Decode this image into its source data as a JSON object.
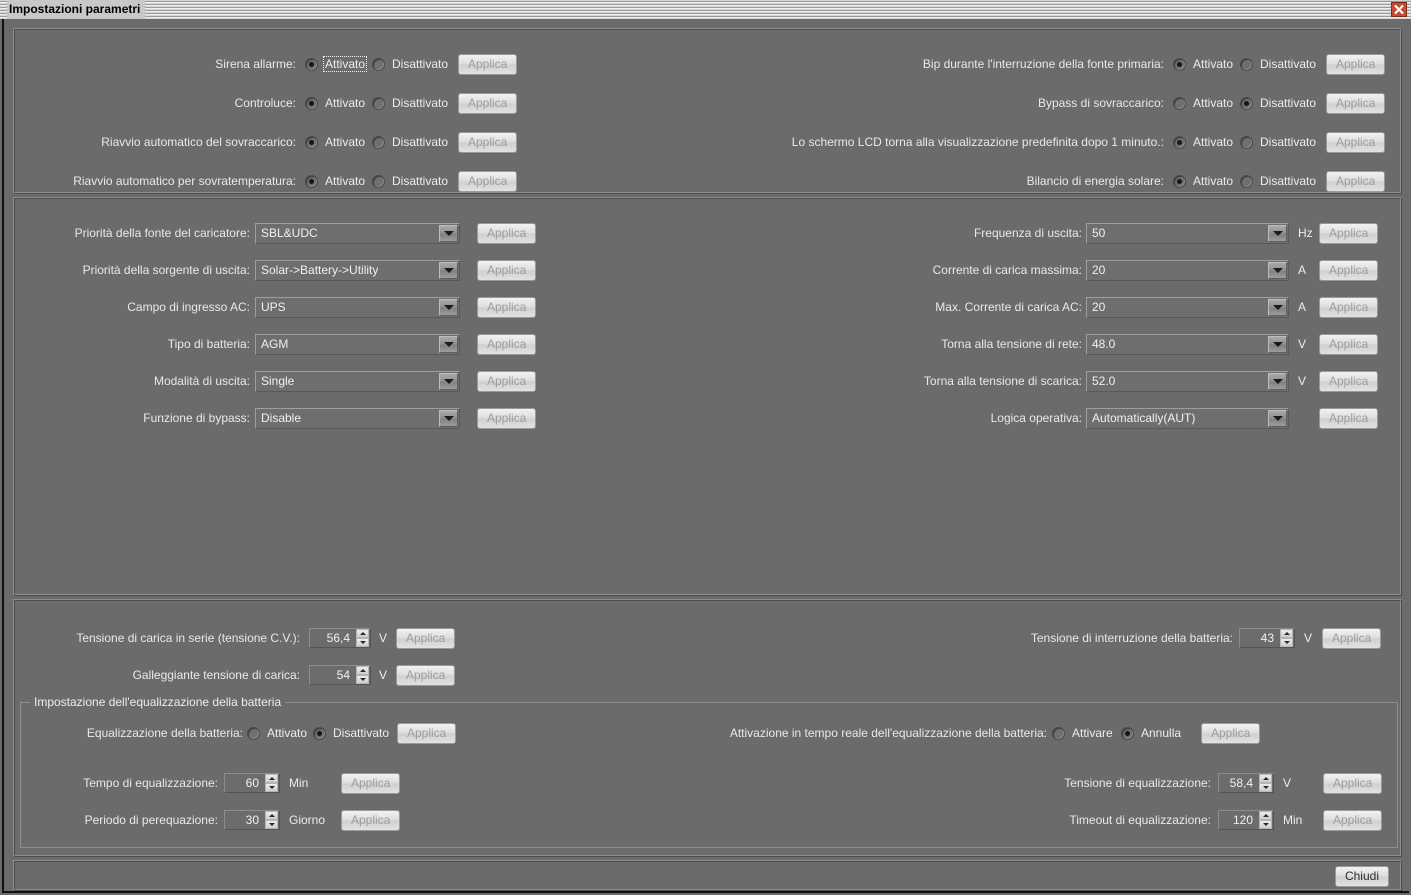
{
  "window": {
    "title": "Impostazioni parametri",
    "close_icon": "close-icon"
  },
  "labels": {
    "apply": "Applica",
    "enabled": "Attivato",
    "disabled": "Disattivato",
    "activate": "Attivare",
    "cancel": "Annulla",
    "close": "Chiudi"
  },
  "toggles_left": [
    {
      "label": "Sirena allarme:",
      "on_label": "Attivato",
      "off_label": "Disattivato",
      "selected": "on",
      "focused": true,
      "apply": "Applica"
    },
    {
      "label": "Controluce:",
      "on_label": "Attivato",
      "off_label": "Disattivato",
      "selected": "on",
      "focused": false,
      "apply": "Applica"
    },
    {
      "label": "Riavvio automatico del sovraccarico:",
      "on_label": "Attivato",
      "off_label": "Disattivato",
      "selected": "on",
      "focused": false,
      "apply": "Applica"
    },
    {
      "label": "Riavvio automatico per sovratemperatura:",
      "on_label": "Attivato",
      "off_label": "Disattivato",
      "selected": "on",
      "focused": false,
      "apply": "Applica"
    }
  ],
  "toggles_right": [
    {
      "label": "Bip durante l'interruzione della fonte primaria:",
      "on_label": "Attivato",
      "off_label": "Disattivato",
      "selected": "on",
      "focused": false,
      "apply": "Applica"
    },
    {
      "label": "Bypass di sovraccarico:",
      "on_label": "Attivato",
      "off_label": "Disattivato",
      "selected": "off",
      "focused": false,
      "apply": "Applica"
    },
    {
      "label": "Lo schermo LCD torna alla visualizzazione predefinita dopo 1 minuto.:",
      "on_label": "Attivato",
      "off_label": "Disattivato",
      "selected": "on",
      "focused": false,
      "apply": "Applica"
    },
    {
      "label": "Bilancio di energia solare:",
      "on_label": "Attivato",
      "off_label": "Disattivato",
      "selected": "on",
      "focused": false,
      "apply": "Applica"
    }
  ],
  "selects_left": [
    {
      "label": "Priorità della fonte del caricatore:",
      "value": "SBL&UDC",
      "unit": "",
      "apply": "Applica"
    },
    {
      "label": "Priorità della sorgente di uscita:",
      "value": "Solar->Battery->Utility",
      "unit": "",
      "apply": "Applica"
    },
    {
      "label": "Campo di ingresso AC:",
      "value": "UPS",
      "unit": "",
      "apply": "Applica"
    },
    {
      "label": "Tipo di batteria:",
      "value": "AGM",
      "unit": "",
      "apply": "Applica"
    },
    {
      "label": "Modalità di uscita:",
      "value": "Single",
      "unit": "",
      "apply": "Applica"
    },
    {
      "label": "Funzione di bypass:",
      "value": "Disable",
      "unit": "",
      "apply": "Applica"
    }
  ],
  "selects_right": [
    {
      "label": "Frequenza di uscita:",
      "value": "50",
      "unit": "Hz",
      "apply": "Applica"
    },
    {
      "label": "Corrente di carica massima:",
      "value": "20",
      "unit": "A",
      "apply": "Applica"
    },
    {
      "label": "Max. Corrente di carica AC:",
      "value": "20",
      "unit": "A",
      "apply": "Applica"
    },
    {
      "label": "Torna alla tensione di rete:",
      "value": "48.0",
      "unit": "V",
      "apply": "Applica"
    },
    {
      "label": "Torna alla tensione di scarica:",
      "value": "52.0",
      "unit": "V",
      "apply": "Applica"
    },
    {
      "label": "Logica operativa:",
      "value": "Automatically(AUT)",
      "unit": "",
      "apply": "Applica"
    }
  ],
  "voltage_left": [
    {
      "label": "Tensione di carica in serie (tensione C.V.):",
      "value": "56,4",
      "unit": "V",
      "apply": "Applica"
    },
    {
      "label": "Galleggiante tensione di carica:",
      "value": "54",
      "unit": "V",
      "apply": "Applica"
    }
  ],
  "voltage_right": [
    {
      "label": "Tensione di interruzione della batteria:",
      "value": "43",
      "unit": "V",
      "apply": "Applica"
    }
  ],
  "equalization": {
    "group_title": "Impostazione dell'equalizzazione della batteria",
    "toggle_left": {
      "label": "Equalizzazione della batteria:",
      "on_label": "Attivato",
      "off_label": "Disattivato",
      "selected": "off",
      "apply": "Applica"
    },
    "toggle_right": {
      "label": "Attivazione in tempo reale dell'equalizzazione della batteria:",
      "on_label": "Attivare",
      "off_label": "Annulla",
      "selected": "off",
      "apply": "Applica"
    },
    "spinners_left": [
      {
        "label": "Tempo di equalizzazione:",
        "value": "60",
        "unit": "Min",
        "apply": "Applica"
      },
      {
        "label": "Periodo di perequazione:",
        "value": "30",
        "unit": "Giorno",
        "apply": "Applica"
      }
    ],
    "spinners_right": [
      {
        "label": "Tensione di equalizzazione:",
        "value": "58,4",
        "unit": "V",
        "apply": "Applica"
      },
      {
        "label": "Timeout di equalizzazione:",
        "value": "120",
        "unit": "Min",
        "apply": "Applica"
      }
    ]
  },
  "footer": {
    "close_label": "Chiudi"
  },
  "colors": {
    "window_bg": "#6b6b6b",
    "titlebar": "#c8c8c8",
    "close_red": "#c94b34",
    "text": "#ededed",
    "button_face": "#dcdcdc",
    "button_disabled_text": "#9d9d9d"
  }
}
